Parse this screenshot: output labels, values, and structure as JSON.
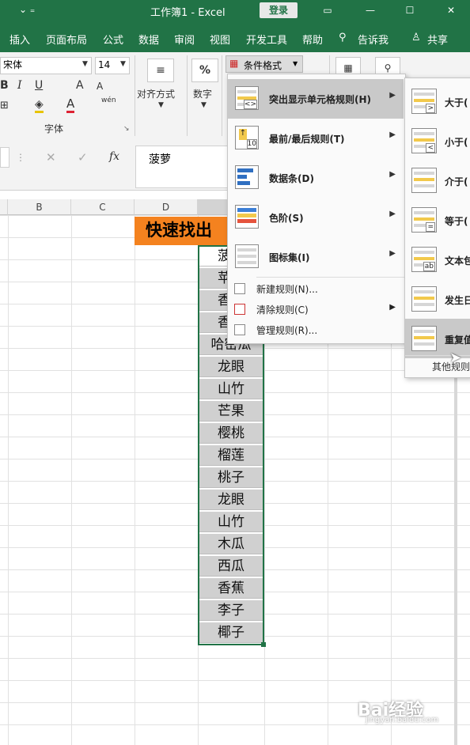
{
  "titlebar": {
    "qat": "⌄   ₌",
    "title": "工作簿1  -  Excel",
    "login": "登录",
    "ribbon_display": "▭",
    "minimize": "—",
    "restore": "☐",
    "close": "✕"
  },
  "tabs": [
    "插入",
    "页面布局",
    "公式",
    "数据",
    "审阅",
    "视图",
    "开发工具",
    "帮助"
  ],
  "tell_me": "告诉我",
  "share": "共享",
  "ribbon": {
    "font_name": "宋体",
    "font_size": "14",
    "bold": "B",
    "italic": "I",
    "underline": "U",
    "increase_font": "A",
    "decrease_font": "A",
    "font_group": "字体",
    "align_label": "对齐方式",
    "number_label": "数字",
    "number_icon": "%",
    "cond_format": "条件格式",
    "wen": "wén"
  },
  "formula_bar": {
    "fx": "fx",
    "value": "菠萝"
  },
  "columns": [
    "B",
    "C",
    "D"
  ],
  "col_e_visible": "",
  "title_cell": "快速找出",
  "fruits": [
    "菠萝",
    "苹果",
    "香蕉",
    "香蕉",
    "哈密瓜",
    "龙眼",
    "山竹",
    "芒果",
    "樱桃",
    "榴莲",
    "桃子",
    "龙眼",
    "山竹",
    "木瓜",
    "西瓜",
    "香蕉",
    "李子",
    "椰子"
  ],
  "menu1": {
    "items": [
      {
        "label": "突出显示单元格规则(H)",
        "icon": "highlight-rules-icon"
      },
      {
        "label": "最前/最后规则(T)",
        "icon": "top-bottom-icon"
      },
      {
        "label": "数据条(D)",
        "icon": "data-bars-icon"
      },
      {
        "label": "色阶(S)",
        "icon": "color-scales-icon"
      },
      {
        "label": "图标集(I)",
        "icon": "icon-sets-icon"
      }
    ],
    "small": [
      {
        "label": "新建规则(N)...",
        "icon": "new-rule-icon"
      },
      {
        "label": "清除规则(C)",
        "icon": "clear-rules-icon"
      },
      {
        "label": "管理规则(R)...",
        "icon": "manage-rules-icon"
      }
    ]
  },
  "menu2": {
    "items": [
      {
        "label": "大于(",
        "sym": ">"
      },
      {
        "label": "小于(",
        "sym": "<"
      },
      {
        "label": "介于(",
        "sym": ""
      },
      {
        "label": "等于(",
        "sym": "="
      },
      {
        "label": "文本包",
        "sym": "ab"
      },
      {
        "label": "发生日",
        "sym": ""
      },
      {
        "label": "重复值",
        "sym": ""
      }
    ],
    "more": "其他规则"
  },
  "watermark": "Bai经验",
  "watermark_sub": "jingyan.baidu.com",
  "colors": {
    "accent": "#217346",
    "title_fill": "#f4821f",
    "selection": "#d0d0d0"
  }
}
